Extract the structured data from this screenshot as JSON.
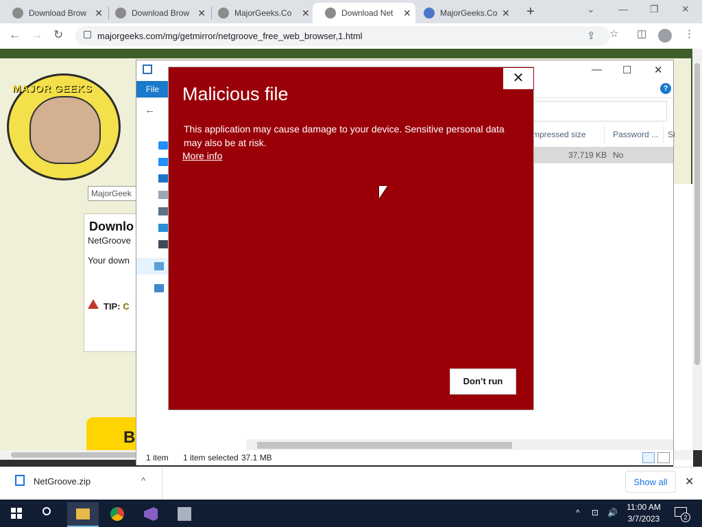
{
  "browser": {
    "tabs": [
      {
        "title": "Download Brow",
        "active": false
      },
      {
        "title": "Download Brow",
        "active": false
      },
      {
        "title": "MajorGeeks.Co",
        "active": false
      },
      {
        "title": "Download Net",
        "active": true
      },
      {
        "title": "MajorGeeks.Co",
        "active": false
      }
    ],
    "new_tab": "+",
    "window_controls": {
      "chevron": "⌄",
      "minimize": "—",
      "restore": "❐",
      "close": "✕"
    },
    "nav": {
      "back": "←",
      "forward": "→",
      "reload": "↻"
    },
    "url": "majorgeeks.com/mg/getmirror/netgroove_free_web_browser,1.html",
    "toolbar_icons": [
      "share-icon",
      "star-icon",
      "sidebar-icon",
      "profile-icon",
      "menu-icon"
    ]
  },
  "page": {
    "logo_text": "MAJOR GEEKS",
    "search_value": "MajorGeek",
    "download_title": "Downlo",
    "download_subtitle": "NetGroove",
    "download_text": "Your down",
    "tip_label": "TIP:",
    "tip_text": "C",
    "banner_letter": "B"
  },
  "explorer": {
    "file_tab": "File",
    "help": "?",
    "columns": [
      "mpressed size",
      "Password ...",
      "Si"
    ],
    "row": {
      "size": "37,719 KB",
      "password": "No"
    },
    "status": {
      "count": "1 item",
      "selected": "1 item selected",
      "size": "37.1 MB"
    }
  },
  "smartscreen": {
    "title": "Malicious file",
    "message": "This application may cause damage to your device. Sensitive personal data may also be at risk.",
    "more_info": "More info",
    "dont_run": "Don’t run",
    "close": "✕",
    "bg_color": "#9a0008"
  },
  "downloads": {
    "file": "NetGroove.zip",
    "chevron": "^",
    "show_all": "Show all",
    "close": "✕"
  },
  "taskbar": {
    "time": "11:00 AM",
    "date": "3/7/2023",
    "notifications": "2",
    "tray": [
      "^",
      "⊡",
      "🔊"
    ]
  }
}
